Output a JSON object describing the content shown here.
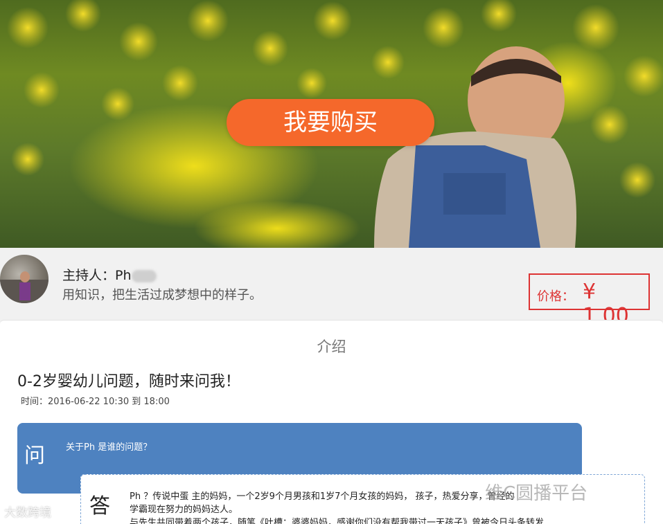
{
  "hero": {
    "buy_button_label": "我要购买",
    "colors": {
      "buy_button": "#f5682b"
    }
  },
  "host": {
    "name_prefix": "主持人：Ph",
    "name_suffix": "lli",
    "motto": "用知识，把生活过成梦想中的样子。",
    "price_label": "价格：",
    "price_value": "¥ 1.00",
    "colors": {
      "price": "#d33333"
    }
  },
  "intro": {
    "section_title": "介绍",
    "topic_title": "0-2岁婴幼儿问题，随时来问我！",
    "time": "时间：2016-06-22 10:30 到 18:00"
  },
  "qa": {
    "question_mark": "问",
    "question_text": "关于Ph 是谁的问题？",
    "answer_mark": "答",
    "answer_line1": "Ph ？传说中蛋 主的妈妈，一个2岁9个月男孩和1岁7个月女孩的妈妈， 孩子，热爱分享，曾经的",
    "answer_line2": "学霸现在努力的妈妈达人。",
    "answer_line3": "与先生共同带着两个孩子，随笔《吐槽：婆婆妈妈，感谢你们没有帮我带过一天孩子》曾被今日头条转发",
    "colors": {
      "question_bg": "#4e82c0"
    }
  },
  "watermarks": {
    "left": "大数跨境",
    "right": "维C圆播平台"
  }
}
